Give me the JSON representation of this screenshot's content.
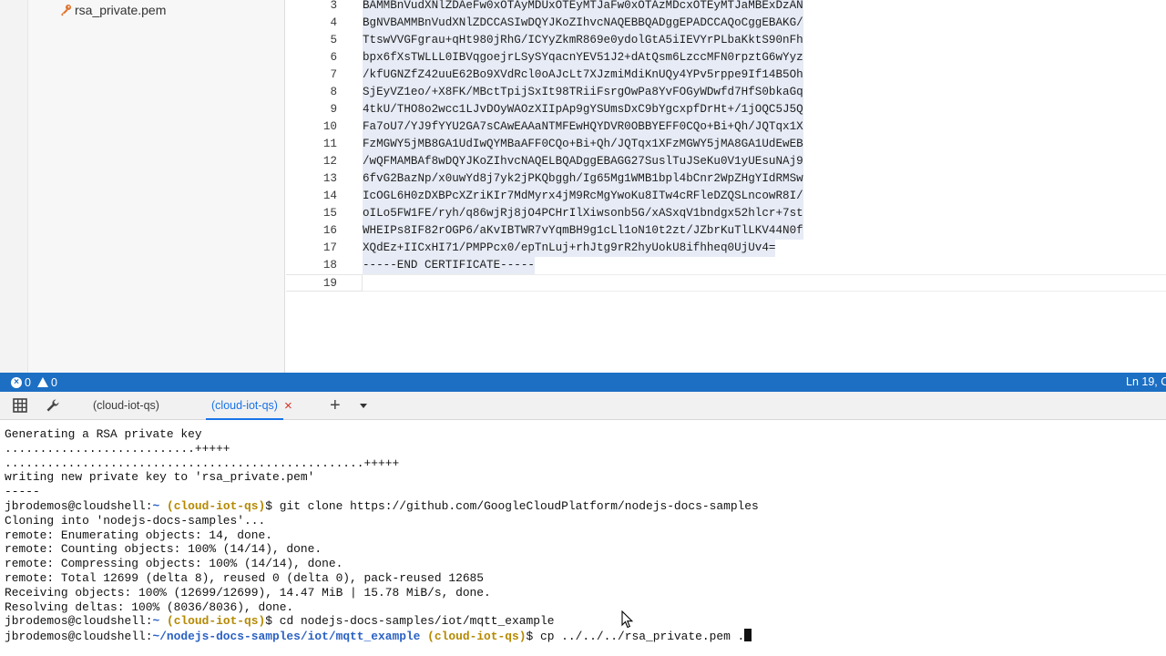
{
  "file_tree": {
    "items": [
      {
        "label": "rsa_private.pem",
        "icon": "key-icon"
      }
    ]
  },
  "editor": {
    "lines": [
      {
        "num": "3",
        "text": "BAMMBnVudXNlZDAeFw0xOTAyMDUxOTEyMTJaFw0xOTAzMDcxOTEyMTJaMBExDzAN"
      },
      {
        "num": "4",
        "text": "BgNVBAMMBnVudXNlZDCCASIwDQYJKoZIhvcNAQEBBQADggEPADCCAQoCggEBAKG/"
      },
      {
        "num": "5",
        "text": "TtswVVGFgrau+qHt980jRhG/ICYyZkmR869e0ydolGtA5iIEVYrPLbaKktS90nFh"
      },
      {
        "num": "6",
        "text": "bpx6fXsTWLLL0IBVqgoejrLSySYqacnYEV51J2+dAtQsm6LzccMFN0rpztG6wYyz"
      },
      {
        "num": "7",
        "text": "/kfUGNZfZ42uuE62Bo9XVdRcl0oAJcLt7XJzmiMdiKnUQy4YPv5rppe9If14B5Oh"
      },
      {
        "num": "8",
        "text": "SjEyVZ1eo/+X8FK/MBctTpijSxIt98TRiiFsrgOwPa8YvFOGyWDwfd7HfS0bkaGq"
      },
      {
        "num": "9",
        "text": "4tkU/THO8o2wcc1LJvDOyWAOzXIIpAp9gYSUmsDxC9bYgcxpfDrHt+/1jOQC5J5Q"
      },
      {
        "num": "10",
        "text": "Fa7oU7/YJ9fYYU2GA7sCAwEAAaNTMFEwHQYDVR0OBBYEFF0CQo+Bi+Qh/JQTqx1X"
      },
      {
        "num": "11",
        "text": "FzMGWY5jMB8GA1UdIwQYMBaAFF0CQo+Bi+Qh/JQTqx1XFzMGWY5jMA8GA1UdEwEB"
      },
      {
        "num": "12",
        "text": "/wQFMAMBAf8wDQYJKoZIhvcNAQELBQADggEBAGG27SuslTuJSeKu0V1yUEsuNAj9"
      },
      {
        "num": "13",
        "text": "6fvG2BazNp/x0uwYd8j7yk2jPKQbggh/Ig65Mg1WMB1bpl4bCnr2WpZHgYIdRMSw"
      },
      {
        "num": "14",
        "text": "IcOGL6H0zDXBPcXZriKIr7MdMyrx4jM9RcMgYwoKu8ITw4cRFleDZQSLncowR8I/"
      },
      {
        "num": "15",
        "text": "oILo5FW1FE/ryh/q86wjRj8jO4PCHrIlXiwsonb5G/xASxqV1bndgx52hlcr+7st"
      },
      {
        "num": "16",
        "text": "WHEIPs8IF82rOGP6/aKvIBTWR7vYqmBH9g1cLl1oN10t2zt/JZbrKuTlLKV44N0f"
      },
      {
        "num": "17",
        "text": "XQdEz+IICxHI71/PMPPcx0/epTnLuj+rhJtg9rR2hyUokU8ifhheq0UjUv4="
      },
      {
        "num": "18",
        "text": "-----END CERTIFICATE-----"
      },
      {
        "num": "19",
        "text": ""
      }
    ]
  },
  "status_bar": {
    "errors": "0",
    "warnings": "0",
    "cursor_position": "Ln 19, C"
  },
  "terminal_tabs": {
    "tabs": [
      {
        "label": "(cloud-iot-qs)"
      },
      {
        "label": "(cloud-iot-qs)"
      }
    ],
    "close_glyph": "×",
    "add_glyph": "+"
  },
  "terminal": {
    "lines": [
      {
        "text": "Generating a RSA private key"
      },
      {
        "text": "...........................+++++"
      },
      {
        "text": "...................................................+++++"
      },
      {
        "text": "writing new private key to 'rsa_private.pem'"
      },
      {
        "text": "-----"
      },
      {
        "user": "jbrodemos@cloudshell:",
        "path": "~",
        "project": "(cloud-iot-qs)",
        "cmd": "$ git clone https://github.com/GoogleCloudPlatform/nodejs-docs-samples"
      },
      {
        "text": "Cloning into 'nodejs-docs-samples'..."
      },
      {
        "text": "remote: Enumerating objects: 14, done."
      },
      {
        "text": "remote: Counting objects: 100% (14/14), done."
      },
      {
        "text": "remote: Compressing objects: 100% (14/14), done."
      },
      {
        "text": "remote: Total 12699 (delta 8), reused 0 (delta 0), pack-reused 12685"
      },
      {
        "text": "Receiving objects: 100% (12699/12699), 14.47 MiB | 15.78 MiB/s, done."
      },
      {
        "text": "Resolving deltas: 100% (8036/8036), done."
      },
      {
        "user": "jbrodemos@cloudshell:",
        "path": "~",
        "project": "(cloud-iot-qs)",
        "cmd": "$ cd nodejs-docs-samples/iot/mqtt_example"
      },
      {
        "user": "jbrodemos@cloudshell:",
        "path": "~/nodejs-docs-samples/iot/mqtt_example",
        "project": "(cloud-iot-qs)",
        "cmd": "$ cp ../../../rsa_private.pem ."
      }
    ]
  },
  "colors": {
    "status_bar_bg": "#1c6fc3",
    "active_tab": "#1a73e8",
    "prompt_project": "#b58900",
    "prompt_path": "#2a61c4",
    "selection": "#e6ebf5"
  }
}
